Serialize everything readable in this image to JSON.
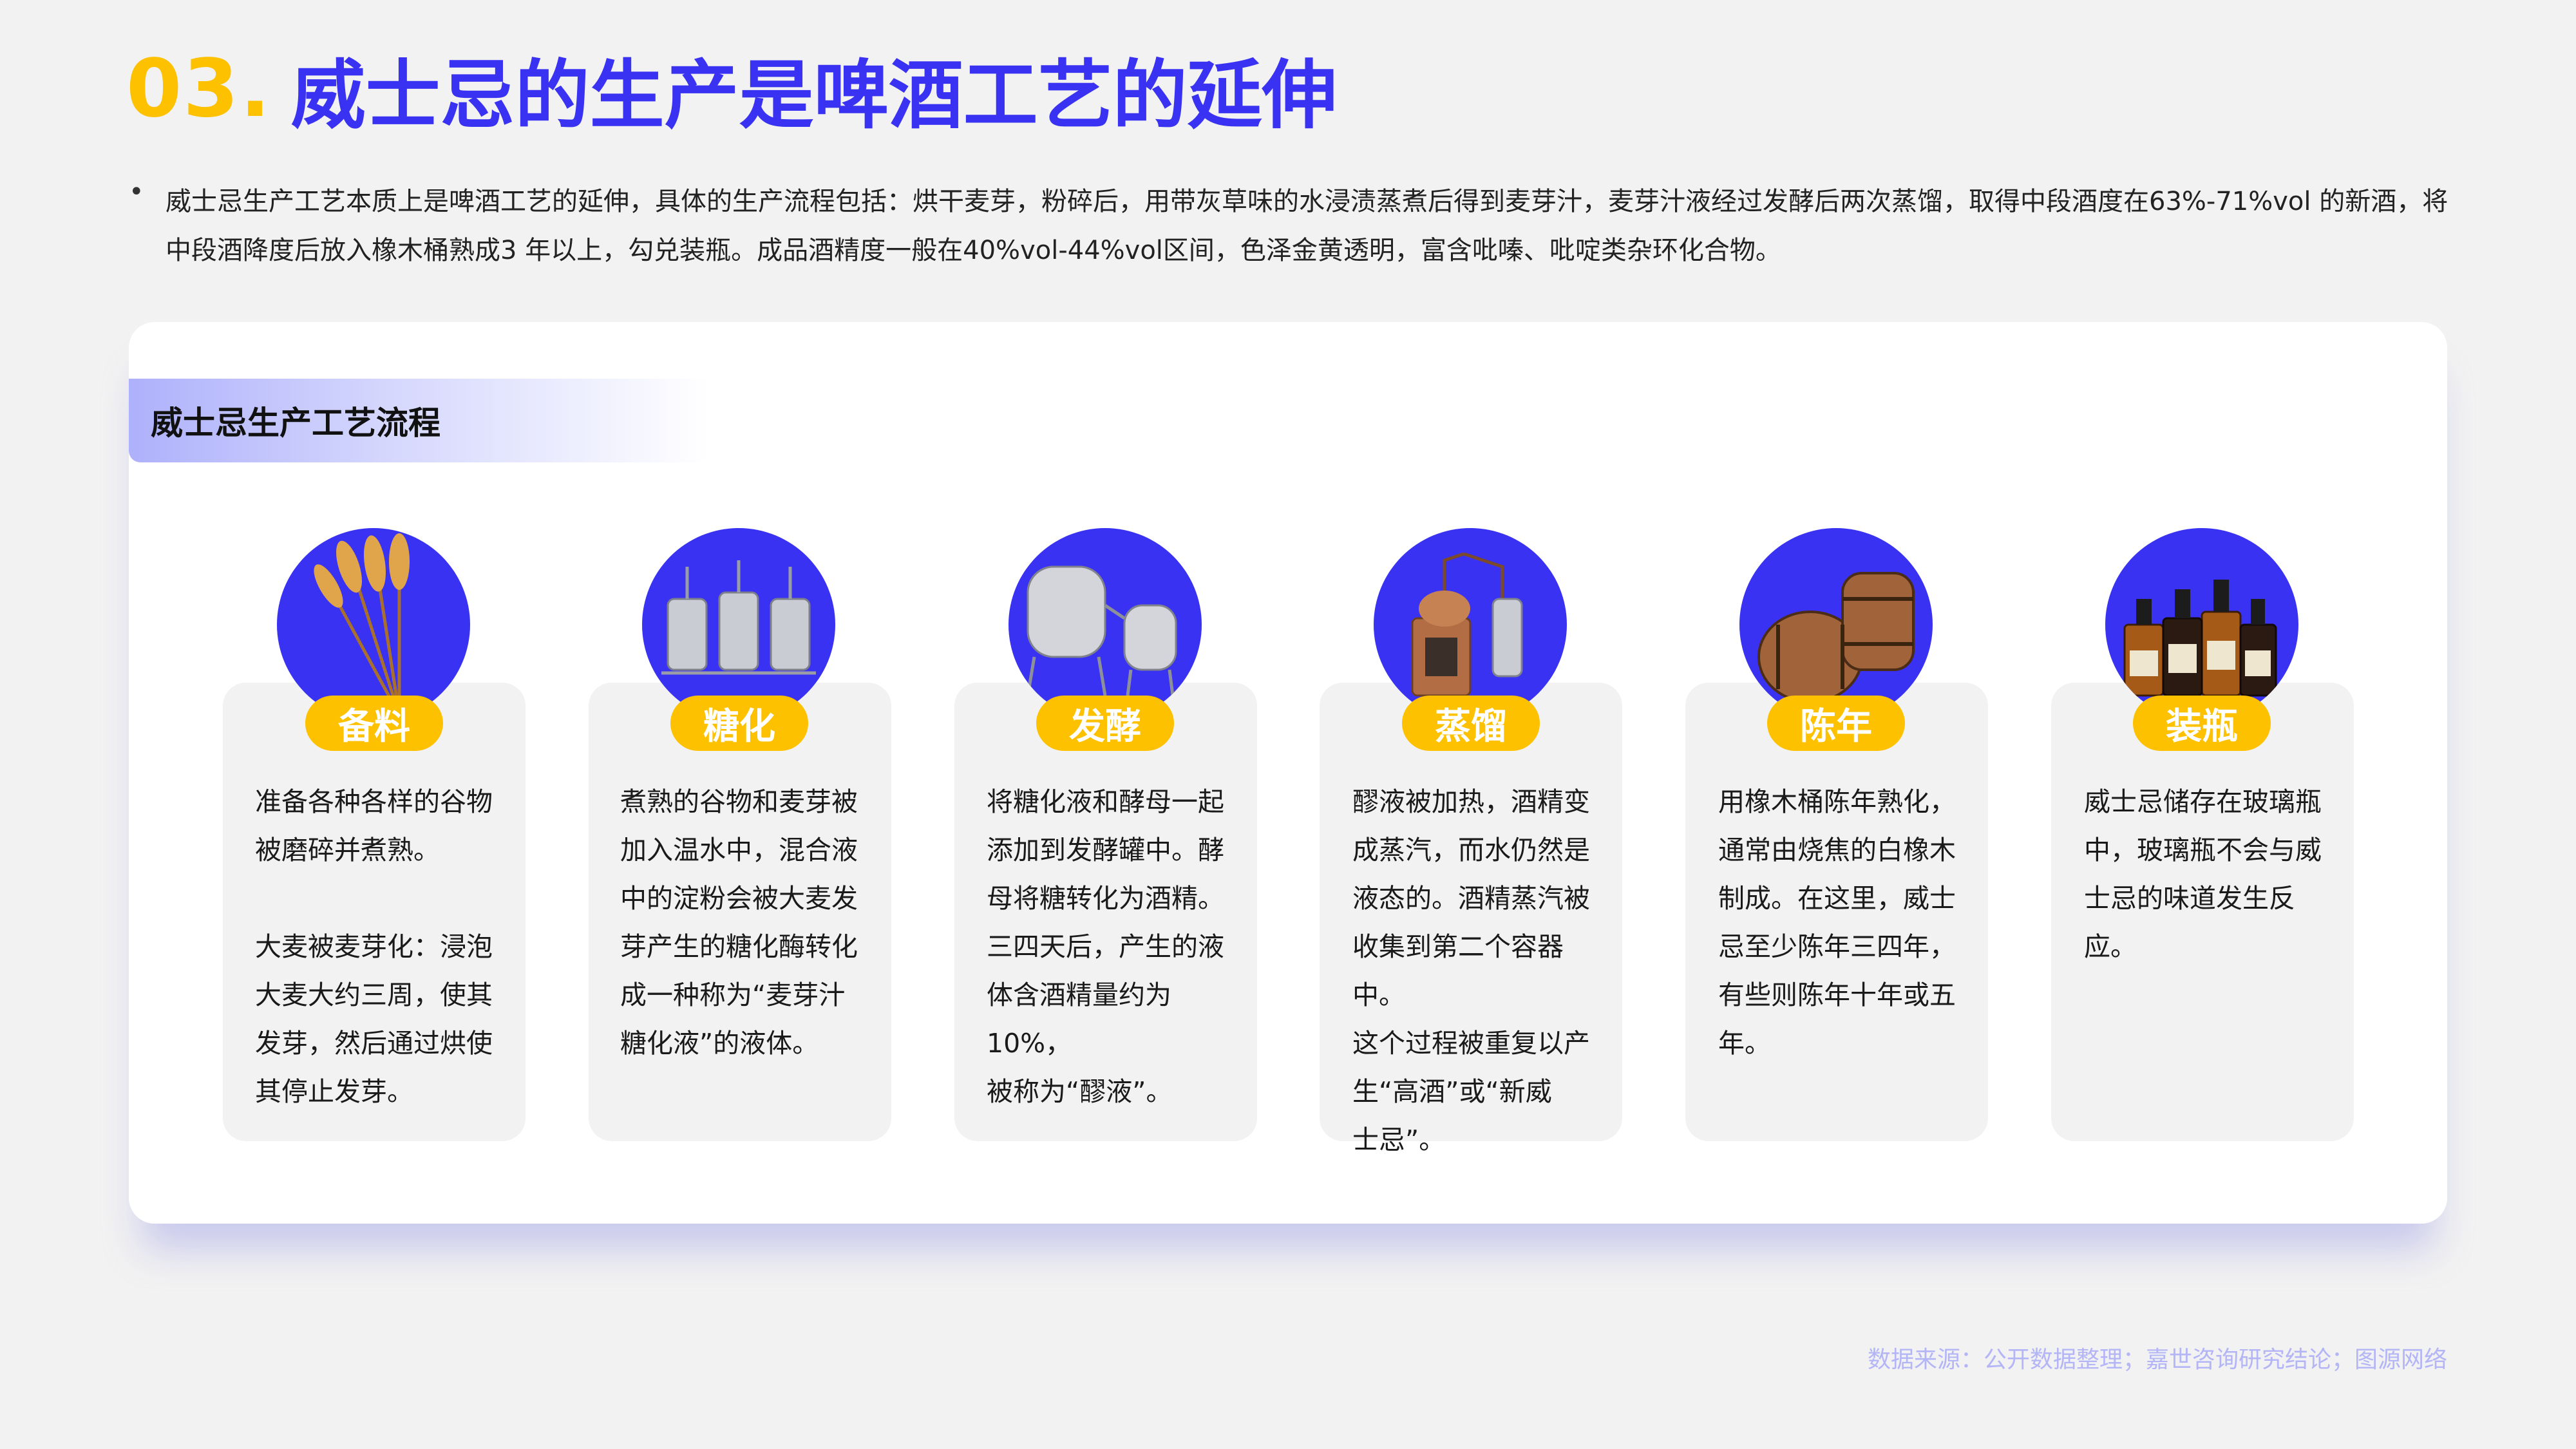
{
  "title": {
    "number": "03.",
    "text": "威士忌的生产是啤酒工艺的延伸"
  },
  "intro": "威士忌生产工艺本质上是啤酒工艺的延伸，具体的生产流程包括：烘干麦芽，粉碎后，用带灰草味的水浸渍蒸煮后得到麦芽汁，麦芽汁液经过发酵后两次蒸馏，取得中段酒度在63%-71%vol 的新酒，将中段酒降度后放入橡木桶熟成3 年以上，勾兑装瓶。成品酒精度一般在40%vol-44%vol区间，色泽金黄透明，富含吡嗪、吡啶类杂环化合物。",
  "panel_title": "威士忌生产工艺流程",
  "steps": [
    {
      "label": "备料",
      "icon": "wheat-icon",
      "desc": "准备各种各样的谷物\n被磨碎并煮熟。\n\n大麦被麦芽化：浸泡\n大麦大约三周，使其\n发芽，然后通过烘使\n其停止发芽。"
    },
    {
      "label": "糖化",
      "icon": "brewing-tanks-icon",
      "desc": "煮熟的谷物和麦芽被\n加入温水中，混合液\n中的淀粉会被大麦发\n芽产生的糖化酶转化\n成一种称为“麦芽汁\n糖化液”的液体。"
    },
    {
      "label": "发酵",
      "icon": "fermentation-tank-icon",
      "desc": "将糖化液和酵母一起\n添加到发酵罐中。酵\n母将糖转化为酒精。\n三四天后，产生的液\n体含酒精量约为10%，\n被称为“醪液”。"
    },
    {
      "label": "蒸馏",
      "icon": "still-icon",
      "desc": "醪液被加热，酒精变\n成蒸汽，而水仍然是\n液态的。酒精蒸汽被\n收集到第二个容器中。\n这个过程被重复以产\n生“高酒”或“新威\n士忌”。"
    },
    {
      "label": "陈年",
      "icon": "barrel-icon",
      "desc": "用橡木桶陈年熟化，\n通常由烧焦的白橡木\n制成。在这里，威士\n忌至少陈年三四年，\n有些则陈年十年或五\n年。"
    },
    {
      "label": "装瓶",
      "icon": "bottles-icon",
      "desc": "威士忌储存在玻璃瓶\n中，玻璃瓶不会与威\n士忌的味道发生反应。"
    }
  ],
  "source": "数据来源：公开数据整理；嘉世咨询研究结论；图源网络",
  "colors": {
    "accent": "#3a32f2",
    "highlight": "#fdc100",
    "card": "#f2f2f2"
  }
}
